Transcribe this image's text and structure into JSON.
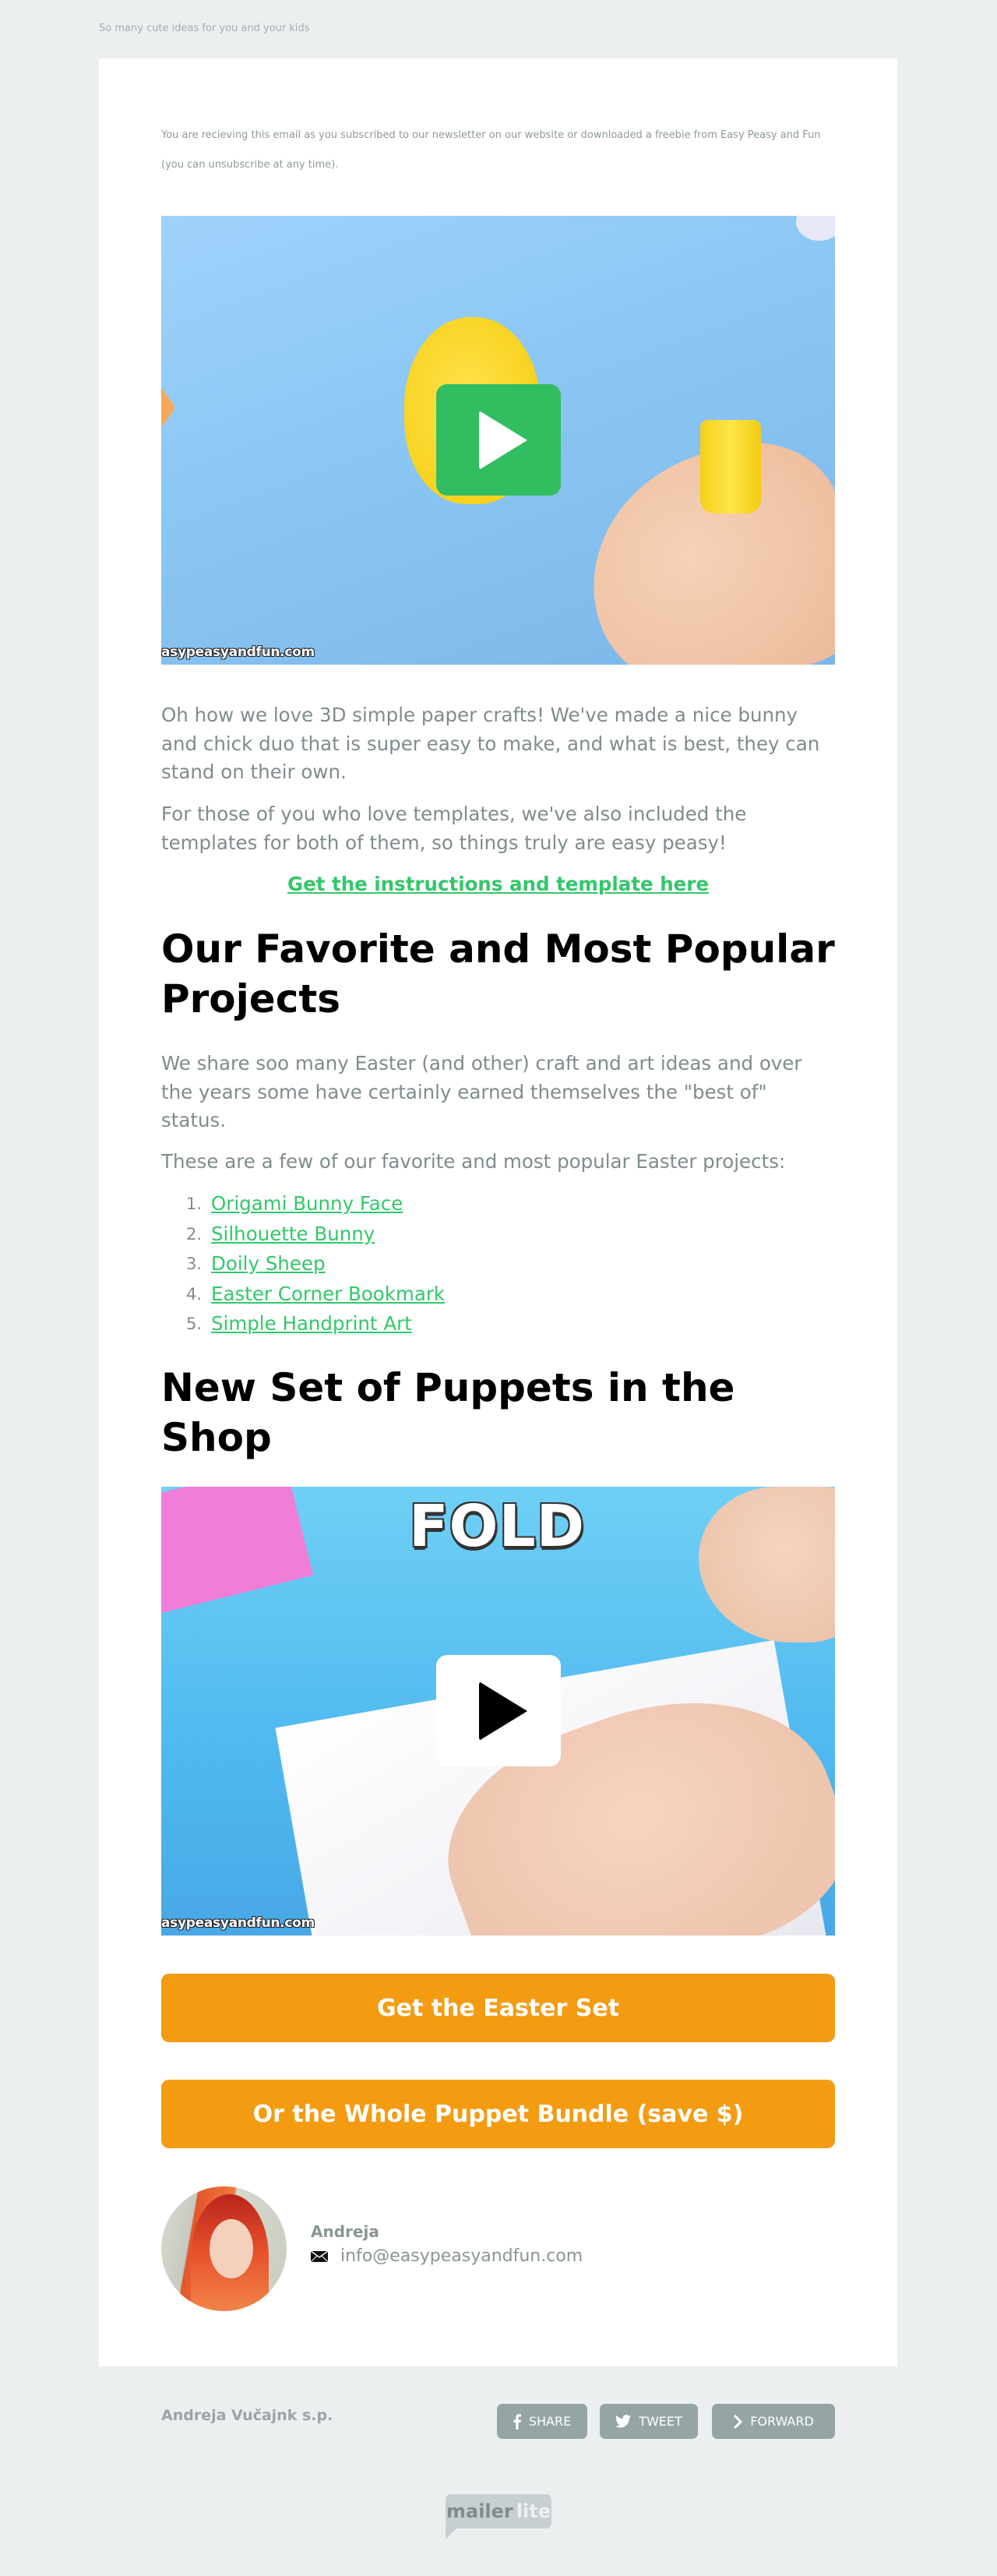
{
  "preheader": "So many cute ideas for you and your kids",
  "notice": "You are recieving this email as you subscribed to our newsletter on our website or downloaded a freebie from Easy Peasy and Fun (you can unsubscribe at any time).",
  "hero": {
    "watermark": "asypeasyandfun.com",
    "play_icon": "play-icon",
    "play_color": "#33bd61"
  },
  "intro": {
    "p1": "Oh how we love 3D simple paper crafts! We've made a nice bunny and chick duo that is super easy to make, and what is best, they can stand on their own.",
    "p2": "For those of you who love templates, we've also included the templates for both of them, so things truly are easy peasy!",
    "link": "Get the instructions and template here "
  },
  "favorites": {
    "heading": "Our Favorite and Most Popular Projects",
    "p1": "We share soo many Easter (and other) craft and art ideas and over the years some have certainly earned themselves the \"best of\" status.",
    "p2": "These are a few of our favorite and most popular Easter projects:",
    "items": [
      {
        "num": "1.",
        "label": "Origami Bunny Face"
      },
      {
        "num": "2.",
        "label": "Silhouette Bunny"
      },
      {
        "num": "3.",
        "label": "Doily Sheep"
      },
      {
        "num": "4.",
        "label": "Easter Corner Bookmark"
      },
      {
        "num": "5.",
        "label": "Simple Handprint Art"
      }
    ]
  },
  "puppets": {
    "heading": "New Set of Puppets in the Shop",
    "video_caption": "FOLD",
    "watermark": "asypeasyandfun.com",
    "button1": "Get the Easter Set",
    "button2": "Or the Whole Puppet Bundle (save $)"
  },
  "author": {
    "name": "Andreja",
    "email": "info@easypeasyandfun.com",
    "email_icon": "envelope-icon"
  },
  "footer": {
    "company": "Andreja Vučajnk s.p.",
    "share": "SHARE",
    "tweet": "TWEET",
    "forward": "FORWARD",
    "logo_left": "mailer",
    "logo_right": "lite"
  },
  "colors": {
    "accent_green": "#33c76a",
    "button_orange": "#f39c12",
    "social_gray": "#95a5a6",
    "text_gray": "#7f8c8d",
    "page_bg": "#ebeff0"
  }
}
